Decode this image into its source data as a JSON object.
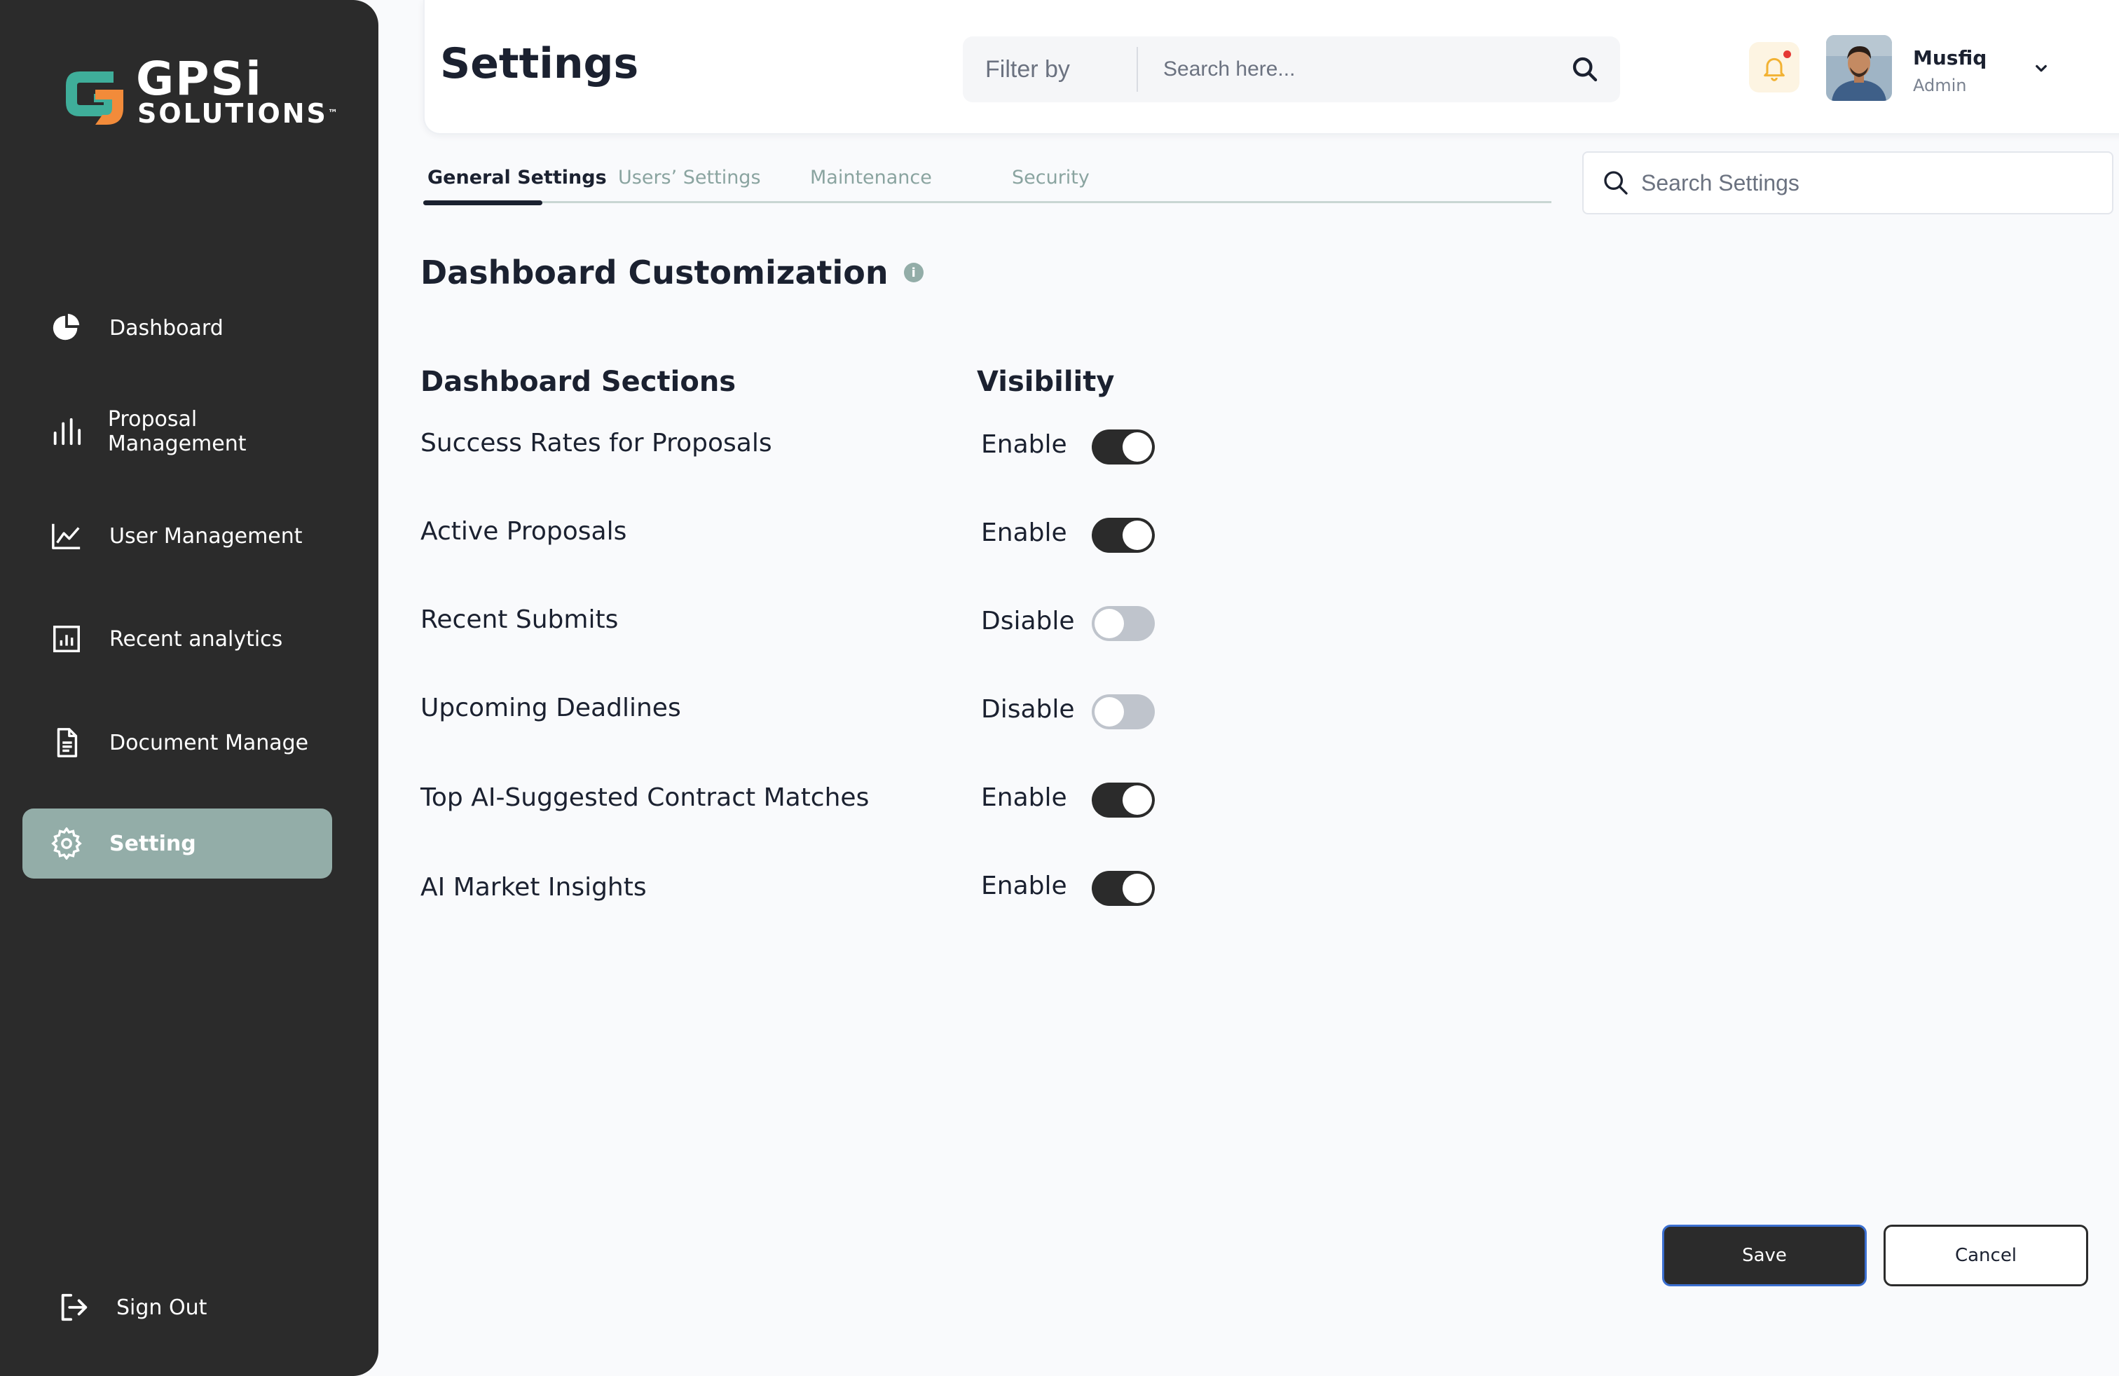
{
  "brand": {
    "name": "GPSi",
    "tagline": "SOLUTIONS",
    "trademark": "™",
    "colors": {
      "mark_teal": "#3fae9a",
      "mark_orange": "#f28b3a"
    }
  },
  "sidebar": {
    "items": [
      {
        "label": "Dashboard",
        "icon": "pie-chart-icon",
        "active": false
      },
      {
        "label": "Proposal Management",
        "icon": "bar-chart-icon",
        "active": false
      },
      {
        "label": "User Management",
        "icon": "line-chart-icon",
        "active": false
      },
      {
        "label": "Recent analytics",
        "icon": "analytics-icon",
        "active": false
      },
      {
        "label": "Document Manage",
        "icon": "document-icon",
        "active": false
      },
      {
        "label": "Setting",
        "icon": "gear-icon",
        "active": true
      }
    ],
    "sign_out": {
      "label": "Sign Out",
      "icon": "sign-out-icon"
    }
  },
  "header": {
    "title": "Settings",
    "filter_label": "Filter by",
    "search_placeholder": "Search here...",
    "user": {
      "name": "Musfiq",
      "role": "Admin"
    },
    "notification_dot": true
  },
  "tabs": [
    {
      "label": "General Settings",
      "active": true
    },
    {
      "label": "Users’ Settings",
      "active": false
    },
    {
      "label": "Maintenance",
      "active": false
    },
    {
      "label": "Security",
      "active": false
    }
  ],
  "settings_search": {
    "placeholder": "Search Settings"
  },
  "content": {
    "section_title": "Dashboard Customization",
    "column_sections": "Dashboard Sections",
    "column_visibility": "Visibility",
    "rows": [
      {
        "label": "Success Rates for Proposals",
        "status": "Enable",
        "on": true
      },
      {
        "label": "Active Proposals",
        "status": "Enable",
        "on": true
      },
      {
        "label": "Recent Submits",
        "status": "Dsiable",
        "on": false
      },
      {
        "label": "Upcoming Deadlines",
        "status": "Disable",
        "on": false
      },
      {
        "label": "Top AI-Suggested Contract Matches",
        "status": "Enable",
        "on": true
      },
      {
        "label": "AI Market Insights",
        "status": "Enable",
        "on": true
      }
    ]
  },
  "footer": {
    "save_label": "Save",
    "cancel_label": "Cancel"
  },
  "colors": {
    "sidebar_bg": "#2b2b2b",
    "active_nav": "#93ada8",
    "toggle_on": "#2b2b2b",
    "toggle_off": "#bfc4cc",
    "accent_border": "#3b6fd0"
  }
}
